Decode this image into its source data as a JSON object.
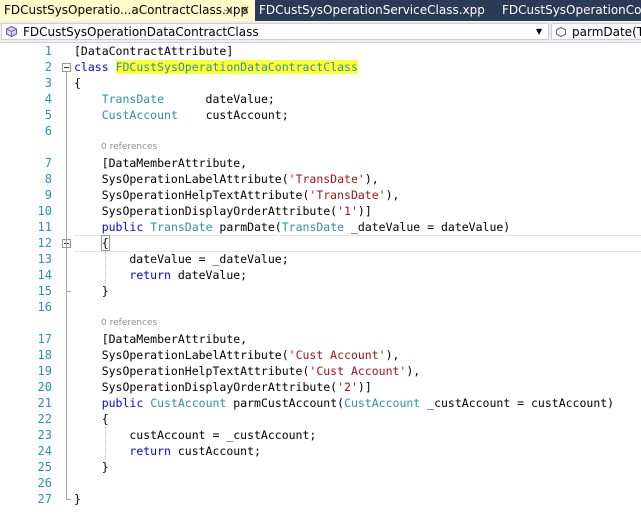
{
  "tabs": [
    {
      "label": "FDCustSysOperatio...aContractClass.xpp",
      "pin": "⊣",
      "close": "×"
    },
    {
      "label": "FDCustSysOperationServiceClass.xpp"
    },
    {
      "label": "FDCustSysOperationContr"
    }
  ],
  "navbar": {
    "type_label": "FDCustSysOperationDataContractClass",
    "member_label": "parmDate(Tra"
  },
  "colors": {
    "keyword": "#0000ff",
    "type": "#2b91af",
    "string": "#a31515",
    "highlight": "#ffff33",
    "tab_bar": "#2b3b55",
    "active_tab": "#fefcc9"
  },
  "code_lines": [
    {
      "n": "1",
      "parts": [
        {
          "t": "[DataContractAttribute]"
        }
      ]
    },
    {
      "n": "2",
      "parts": [
        {
          "t": "class",
          "c": "kw"
        },
        {
          "t": " "
        },
        {
          "t": "FDCustSysOperationDataContractClass",
          "c": "ty hl"
        }
      ]
    },
    {
      "n": "3",
      "parts": [
        {
          "t": "{"
        }
      ]
    },
    {
      "n": "4",
      "parts": [
        {
          "t": "    "
        },
        {
          "t": "TransDate",
          "c": "ty"
        },
        {
          "t": "      dateValue;"
        }
      ]
    },
    {
      "n": "5",
      "parts": [
        {
          "t": "    "
        },
        {
          "t": "CustAccount",
          "c": "ty"
        },
        {
          "t": "    custAccount;"
        }
      ]
    },
    {
      "n": "6",
      "parts": [
        {
          "t": ""
        }
      ]
    },
    {
      "n": "7",
      "parts": [
        {
          "t": "    [DataMemberAttribute,"
        }
      ],
      "ref": "0 references"
    },
    {
      "n": "8",
      "parts": [
        {
          "t": "    SysOperationLabelAttribute("
        },
        {
          "t": "'TransDate'",
          "c": "st"
        },
        {
          "t": "),"
        }
      ]
    },
    {
      "n": "9",
      "parts": [
        {
          "t": "    SysOperationHelpTextAttribute("
        },
        {
          "t": "'TransDate'",
          "c": "st"
        },
        {
          "t": "),"
        }
      ]
    },
    {
      "n": "10",
      "parts": [
        {
          "t": "    SysOperationDisplayOrderAttribute("
        },
        {
          "t": "'1'",
          "c": "st"
        },
        {
          "t": ")]"
        }
      ]
    },
    {
      "n": "11",
      "parts": [
        {
          "t": "    "
        },
        {
          "t": "public",
          "c": "kw"
        },
        {
          "t": " "
        },
        {
          "t": "TransDate",
          "c": "ty"
        },
        {
          "t": " parmDate("
        },
        {
          "t": "TransDate",
          "c": "ty"
        },
        {
          "t": " _dateValue = dateValue)"
        }
      ]
    },
    {
      "n": "12",
      "parts": [
        {
          "t": "    "
        },
        {
          "t": "{",
          "c": "selcur"
        }
      ]
    },
    {
      "n": "13",
      "parts": [
        {
          "t": "        dateValue = _dateValue;"
        }
      ]
    },
    {
      "n": "14",
      "parts": [
        {
          "t": "        "
        },
        {
          "t": "return",
          "c": "kw"
        },
        {
          "t": " dateValue;"
        }
      ]
    },
    {
      "n": "15",
      "parts": [
        {
          "t": "    }"
        }
      ]
    },
    {
      "n": "16",
      "parts": [
        {
          "t": ""
        }
      ]
    },
    {
      "n": "17",
      "parts": [
        {
          "t": "    [DataMemberAttribute,"
        }
      ],
      "ref": "0 references"
    },
    {
      "n": "18",
      "parts": [
        {
          "t": "    SysOperationLabelAttribute("
        },
        {
          "t": "'Cust Account'",
          "c": "st"
        },
        {
          "t": "),"
        }
      ]
    },
    {
      "n": "19",
      "parts": [
        {
          "t": "    SysOperationHelpTextAttribute("
        },
        {
          "t": "'Cust Account'",
          "c": "st"
        },
        {
          "t": "),"
        }
      ]
    },
    {
      "n": "20",
      "parts": [
        {
          "t": "    SysOperationDisplayOrderAttribute("
        },
        {
          "t": "'2'",
          "c": "st"
        },
        {
          "t": ")]"
        }
      ]
    },
    {
      "n": "21",
      "parts": [
        {
          "t": "    "
        },
        {
          "t": "public",
          "c": "kw"
        },
        {
          "t": " "
        },
        {
          "t": "CustAccount",
          "c": "ty"
        },
        {
          "t": " parmCustAccount("
        },
        {
          "t": "CustAccount",
          "c": "ty"
        },
        {
          "t": " _custAccount = custAccount)"
        }
      ]
    },
    {
      "n": "22",
      "parts": [
        {
          "t": "    {"
        }
      ]
    },
    {
      "n": "23",
      "parts": [
        {
          "t": "        custAccount = _custAccount;"
        }
      ]
    },
    {
      "n": "24",
      "parts": [
        {
          "t": "        "
        },
        {
          "t": "return",
          "c": "kw"
        },
        {
          "t": " custAccount;"
        }
      ]
    },
    {
      "n": "25",
      "parts": [
        {
          "t": "    }"
        }
      ]
    },
    {
      "n": "26",
      "parts": [
        {
          "t": ""
        }
      ]
    },
    {
      "n": "27",
      "parts": [
        {
          "t": "}"
        }
      ]
    }
  ]
}
